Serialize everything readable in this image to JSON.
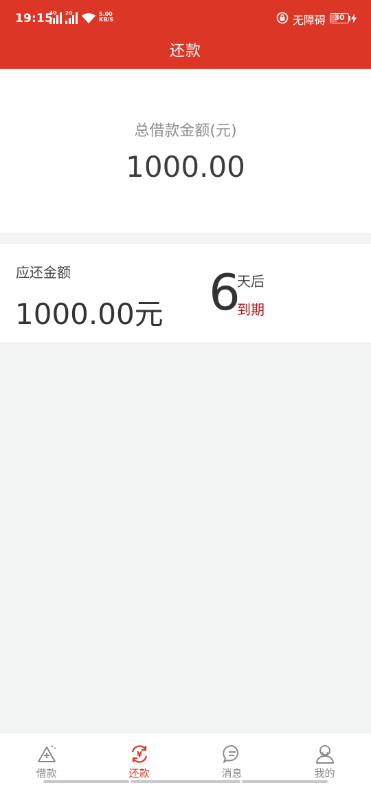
{
  "status_bar": {
    "time": "19:15",
    "signal_1_tag": "4G",
    "signal_2_tag": "2G",
    "speed_value": "5.00",
    "speed_unit": "KB/S",
    "accessibility_text": "无障碍",
    "battery_level": "30"
  },
  "header": {
    "title": "还款"
  },
  "summary": {
    "label": "总借款金额(元)",
    "amount": "1000.00"
  },
  "due": {
    "label": "应还金额",
    "amount": "1000.00元",
    "days": "6",
    "days_suffix": "天后",
    "due_text": "到期"
  },
  "tabbar": {
    "items": [
      {
        "label": "借款",
        "icon": "loan-icon"
      },
      {
        "label": "还款",
        "icon": "repay-icon"
      },
      {
        "label": "消息",
        "icon": "message-icon"
      },
      {
        "label": "我的",
        "icon": "profile-icon"
      }
    ],
    "active_index": 1
  },
  "colors": {
    "brand_red": "#dc3626",
    "due_red": "#b5121b",
    "background": "#f3f4f4"
  }
}
